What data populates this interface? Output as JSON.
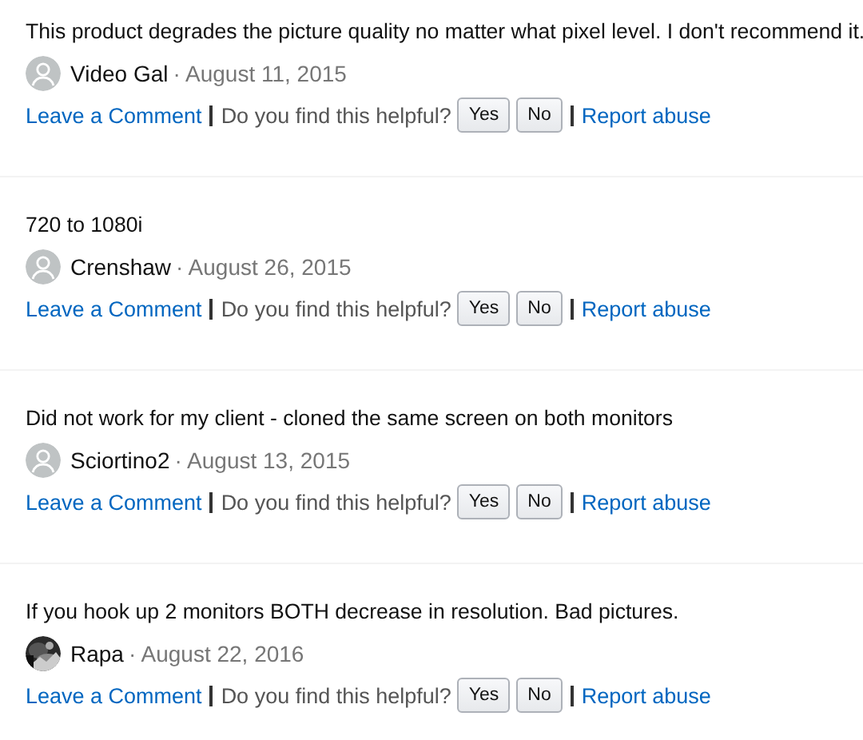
{
  "reviews": [
    {
      "text": "This product degrades the picture quality no matter what pixel level. I don't recommend it.",
      "avatar": {
        "kind": "default"
      },
      "author": "Video Gal",
      "date": "· August 11, 2015",
      "comment_link": "Leave a Comment",
      "helpful_prompt": "Do you find this helpful?",
      "buttons": [
        "Yes",
        "No"
      ],
      "report_link": "Report abuse"
    },
    {
      "text": "720 to 1080i",
      "avatar": {
        "kind": "default"
      },
      "author": "Crenshaw",
      "date": "· August 26, 2015",
      "comment_link": "Leave a Comment",
      "helpful_prompt": "Do you find this helpful?",
      "buttons": [
        "Yes",
        "No"
      ],
      "report_link": "Report abuse"
    },
    {
      "text": "Did not work for my client - cloned the same screen on both monitors",
      "avatar": {
        "kind": "default"
      },
      "author": "Sciortino2",
      "date": "· August 13, 2015",
      "comment_link": "Leave a Comment",
      "helpful_prompt": "Do you find this helpful?",
      "buttons": [
        "Yes",
        "No"
      ],
      "report_link": "Report abuse"
    },
    {
      "text": "If you hook up 2 monitors BOTH decrease in resolution. Bad pictures.",
      "author": "Rapa",
      "date": "· August 22, 2016",
      "comment_link": "Leave a Comment",
      "helpful_prompt": "Do you find this helpful?",
      "buttons": [
        "Yes",
        "No"
      ],
      "report_link": "Report abuse"
    }
  ]
}
